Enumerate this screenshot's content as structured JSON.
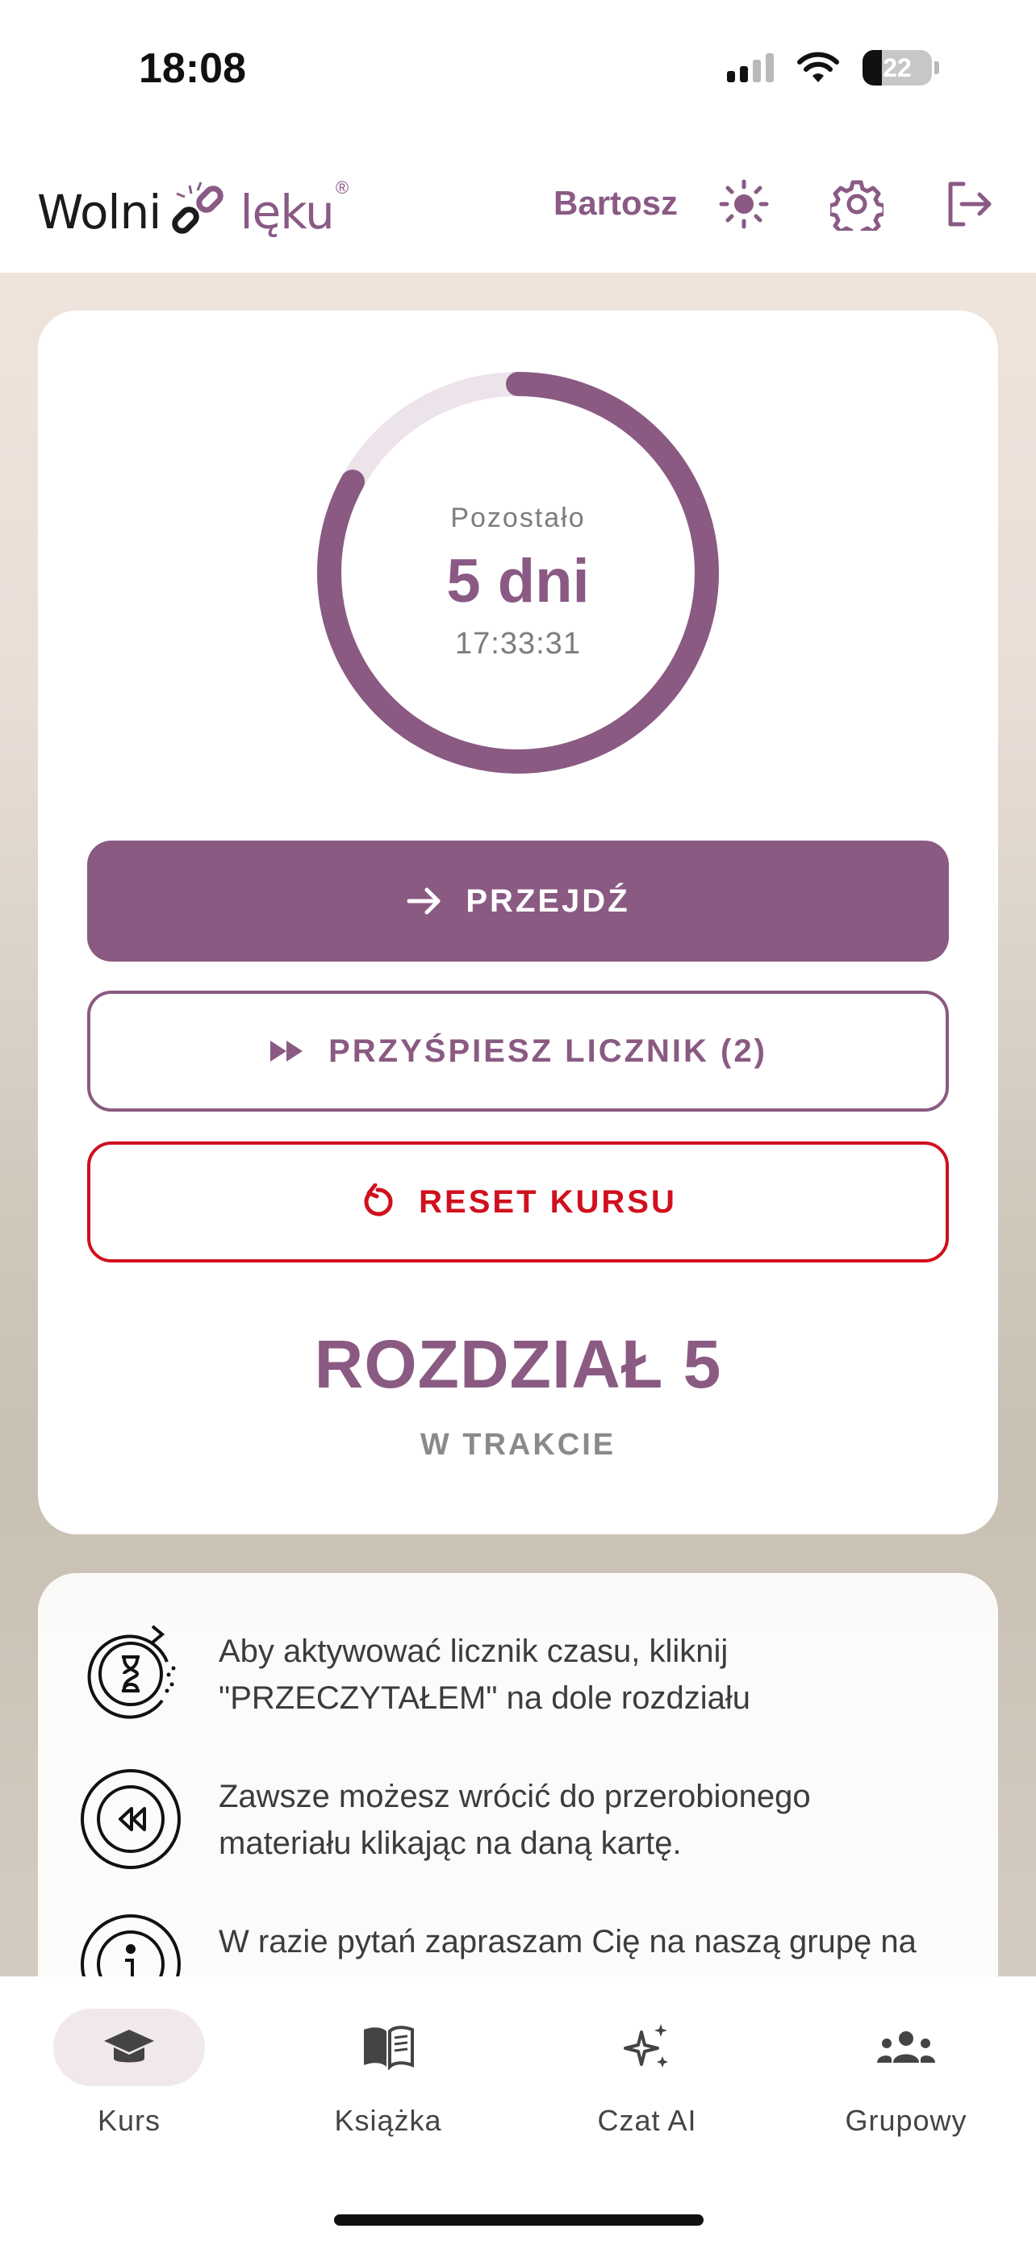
{
  "status_bar": {
    "time": "18:08",
    "battery_level": "22"
  },
  "header": {
    "logo_part1": "Wolni",
    "logo_part2": "lęku",
    "logo_reg": "®",
    "user_name": "Bartosz",
    "icons": [
      "sun-icon",
      "gear-icon",
      "logout-icon"
    ]
  },
  "timer": {
    "label": "Pozostało",
    "days": "5 dni",
    "time": "17:33:31",
    "progress_fraction": 0.83
  },
  "buttons": {
    "go": "PRZEJDŹ",
    "speed_up": "PRZYŚPIESZ LICZNIK (2)",
    "reset": "RESET KURSU"
  },
  "chapter": {
    "title": "ROZDZIAŁ 5",
    "status": "W TRAKCIE"
  },
  "info": {
    "items": [
      {
        "line1": "Aby aktywować licznik czasu, kliknij",
        "line2": "\"PRZECZYTAŁEM\" na dole rozdziału"
      },
      {
        "line1": "Zawsze możesz wrócić do przerobionego",
        "line2": "materiału klikając na daną kartę."
      },
      {
        "line1": "W razie pytań zapraszam Cię na naszą grupę na",
        "line2": ""
      }
    ]
  },
  "nav": {
    "items": [
      {
        "label": "Kurs",
        "icon": "graduation-cap-icon"
      },
      {
        "label": "Książka",
        "icon": "book-icon"
      },
      {
        "label": "Czat AI",
        "icon": "sparkles-icon"
      },
      {
        "label": "Grupowy",
        "icon": "group-icon"
      }
    ]
  },
  "colors": {
    "accent": "#8a5a82",
    "danger": "#d0101e",
    "active_pill": "#f1e8ee"
  }
}
